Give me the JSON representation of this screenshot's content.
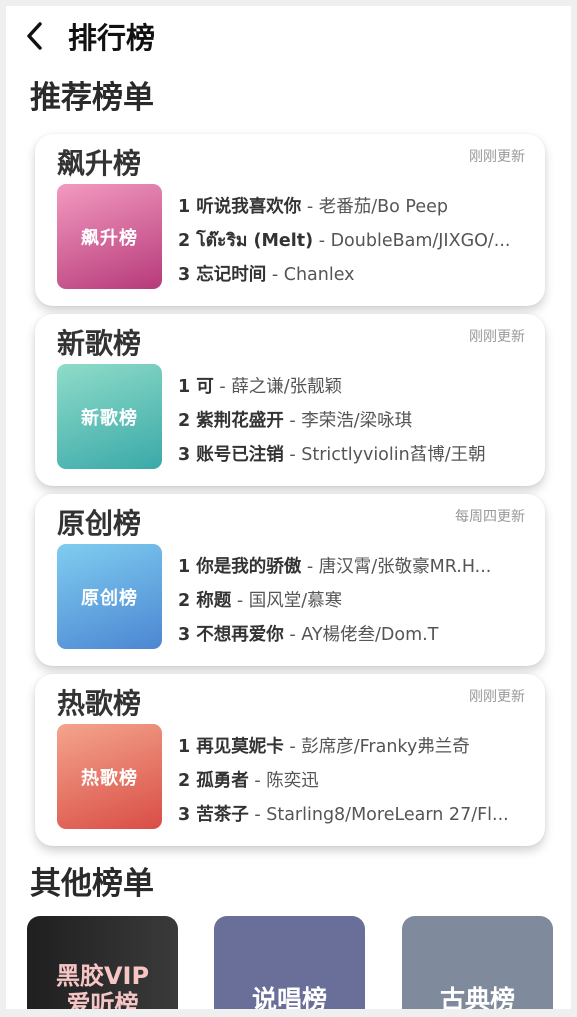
{
  "header": {
    "title": "排行榜"
  },
  "recommended": {
    "title": "推荐榜单",
    "cards": [
      {
        "title": "飙升榜",
        "update": "刚刚更新",
        "cover_text": "飙升榜",
        "cover_colors": [
          "#f39ac0",
          "#b63a7a"
        ],
        "songs": [
          {
            "rank": "1",
            "name": "听说我喜欢你",
            "artist": "老番茄/Bo Peep"
          },
          {
            "rank": "2",
            "name": "โต๊ะริม (Melt)",
            "artist": "DoubleBam/JIXGO/..."
          },
          {
            "rank": "3",
            "name": "忘记时间",
            "artist": "Chanlex"
          }
        ]
      },
      {
        "title": "新歌榜",
        "update": "刚刚更新",
        "cover_text": "新歌榜",
        "cover_colors": [
          "#8fdcc8",
          "#3aa9a9"
        ],
        "songs": [
          {
            "rank": "1",
            "name": "可",
            "artist": "薛之谦/张靓颖"
          },
          {
            "rank": "2",
            "name": "紫荆花盛开",
            "artist": "李荣浩/梁咏琪"
          },
          {
            "rank": "3",
            "name": "账号已注销",
            "artist": "Strictlyviolin萏博/王朝"
          }
        ]
      },
      {
        "title": "原创榜",
        "update": "每周四更新",
        "cover_text": "原创榜",
        "cover_colors": [
          "#7fcdf0",
          "#4c86d2"
        ],
        "songs": [
          {
            "rank": "1",
            "name": "你是我的骄傲",
            "artist": "唐汉霄/张敬豪MR.H..."
          },
          {
            "rank": "2",
            "name": "称题",
            "artist": "国风堂/慕寒"
          },
          {
            "rank": "3",
            "name": "不想再爱你",
            "artist": "AY楊佬叁/Dom.T"
          }
        ]
      },
      {
        "title": "热歌榜",
        "update": "刚刚更新",
        "cover_text": "热歌榜",
        "cover_colors": [
          "#f4a58c",
          "#d94d46"
        ],
        "songs": [
          {
            "rank": "1",
            "name": "再见莫妮卡",
            "artist": "彭席彦/Franky弗兰奇"
          },
          {
            "rank": "2",
            "name": "孤勇者",
            "artist": "陈奕迅"
          },
          {
            "rank": "3",
            "name": "苦茶子",
            "artist": "Starling8/MoreLearn 27/Fl..."
          }
        ]
      }
    ]
  },
  "others": {
    "title": "其他榜单",
    "tiles": [
      {
        "label": "黑胶VIP爱听榜",
        "line1": "黑胶VIP",
        "line2": "爱听榜",
        "color": "#2a2a2a"
      },
      {
        "label": "说唱榜",
        "color": "#6a6f9a"
      },
      {
        "label": "古典榜",
        "color": "#7f8b9c"
      }
    ]
  }
}
